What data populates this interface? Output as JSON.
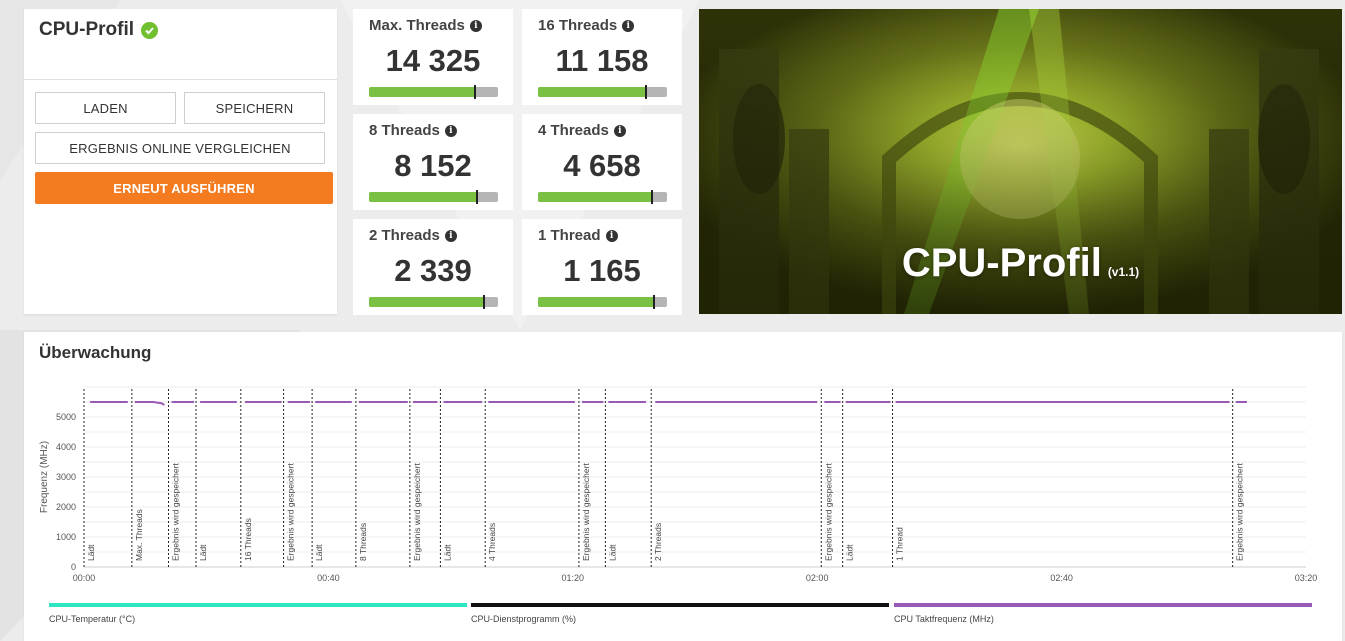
{
  "colors": {
    "accent_orange": "#f47b20",
    "success_green": "#6fbf2f",
    "score_bar_green": "#7ac143",
    "line_purple": "#9b59b6",
    "temp_teal": "#2ee6c0",
    "util_black": "#111111"
  },
  "left_panel": {
    "title": "CPU-Profil",
    "status_icon": "check-circle-icon",
    "load_label": "LADEN",
    "save_label": "SPEICHERN",
    "compare_label": "ERGEBNIS ONLINE VERGLEICHEN",
    "rerun_label": "ERNEUT AUSFÜHREN"
  },
  "scores": [
    {
      "label": "Max. Threads",
      "value": "14 325",
      "fraction": 0.82
    },
    {
      "label": "16 Threads",
      "value": "11 158",
      "fraction": 0.84
    },
    {
      "label": "8 Threads",
      "value": "8 152",
      "fraction": 0.84
    },
    {
      "label": "4 Threads",
      "value": "4 658",
      "fraction": 0.88
    },
    {
      "label": "2 Threads",
      "value": "2 339",
      "fraction": 0.89
    },
    {
      "label": "1 Thread",
      "value": "1 165",
      "fraction": 0.9
    }
  ],
  "hero": {
    "title": "CPU-Profil",
    "version": "(v1.1)"
  },
  "monitoring": {
    "title": "Überwachung",
    "legend": [
      {
        "label": "CPU-Temperatur (°C)",
        "color": "#2ee6c0"
      },
      {
        "label": "CPU-Dienstprogramm (%)",
        "color": "#111111"
      },
      {
        "label": "CPU Taktfrequenz (MHz)",
        "color": "#9b59b6"
      }
    ]
  },
  "chart_data": {
    "type": "line",
    "ylabel": "Frequenz (MHz)",
    "xlabel": "",
    "ylim": [
      0,
      6000
    ],
    "xlim_seconds": [
      0,
      12000
    ],
    "y_ticks": [
      0,
      1000,
      2000,
      3000,
      4000,
      5000
    ],
    "x_ticks": [
      {
        "t": 0,
        "label": "00:00"
      },
      {
        "t": 2400,
        "label": "00:40"
      },
      {
        "t": 4800,
        "label": "01:20"
      },
      {
        "t": 7200,
        "label": "02:00"
      },
      {
        "t": 9600,
        "label": "02:40"
      },
      {
        "t": 12000,
        "label": "03:20"
      }
    ],
    "markers": [
      {
        "t": 0,
        "label": "Lädt"
      },
      {
        "t": 470,
        "label": "Max. Threads"
      },
      {
        "t": 830,
        "label": "Ergebnis wird gespeichert"
      },
      {
        "t": 1100,
        "label": "Lädt"
      },
      {
        "t": 1540,
        "label": "16 Threads"
      },
      {
        "t": 1960,
        "label": "Ergebnis wird gespeichert"
      },
      {
        "t": 2240,
        "label": "Lädt"
      },
      {
        "t": 2670,
        "label": "8 Threads"
      },
      {
        "t": 3200,
        "label": "Ergebnis wird gespeichert"
      },
      {
        "t": 3500,
        "label": "Lädt"
      },
      {
        "t": 3940,
        "label": "4 Threads"
      },
      {
        "t": 4860,
        "label": "Ergebnis wird gespeichert"
      },
      {
        "t": 5120,
        "label": "Lädt"
      },
      {
        "t": 5570,
        "label": "2 Threads"
      },
      {
        "t": 7240,
        "label": "Ergebnis wird gespeichert"
      },
      {
        "t": 7450,
        "label": "Lädt"
      },
      {
        "t": 7940,
        "label": "1 Thread"
      },
      {
        "t": 11280,
        "label": "Ergebnis wird gespeichert"
      }
    ],
    "series": [
      {
        "name": "CPU Taktfrequenz (MHz)",
        "color": "#9b59b6",
        "segments": [
          [
            [
              60,
              5500
            ],
            [
              430,
              5500
            ]
          ],
          [
            [
              500,
              5500
            ],
            [
              680,
              5500
            ],
            [
              760,
              5460
            ],
            [
              790,
              5400
            ]
          ],
          [
            [
              860,
              5500
            ],
            [
              1080,
              5500
            ]
          ],
          [
            [
              1140,
              5500
            ],
            [
              1500,
              5500
            ]
          ],
          [
            [
              1580,
              5500
            ],
            [
              1940,
              5500
            ]
          ],
          [
            [
              2000,
              5500
            ],
            [
              2220,
              5500
            ]
          ],
          [
            [
              2270,
              5500
            ],
            [
              2630,
              5500
            ]
          ],
          [
            [
              2700,
              5500
            ],
            [
              3180,
              5500
            ]
          ],
          [
            [
              3230,
              5500
            ],
            [
              3470,
              5500
            ]
          ],
          [
            [
              3530,
              5500
            ],
            [
              3910,
              5500
            ]
          ],
          [
            [
              3970,
              5500
            ],
            [
              4820,
              5500
            ]
          ],
          [
            [
              4890,
              5500
            ],
            [
              5100,
              5500
            ]
          ],
          [
            [
              5150,
              5500
            ],
            [
              5520,
              5500
            ]
          ],
          [
            [
              5610,
              5500
            ],
            [
              7200,
              5500
            ]
          ],
          [
            [
              7270,
              5500
            ],
            [
              7430,
              5500
            ]
          ],
          [
            [
              7480,
              5500
            ],
            [
              7920,
              5500
            ]
          ],
          [
            [
              7970,
              5500
            ],
            [
              11250,
              5500
            ]
          ],
          [
            [
              11310,
              5500
            ],
            [
              11420,
              5500
            ]
          ]
        ]
      }
    ]
  }
}
